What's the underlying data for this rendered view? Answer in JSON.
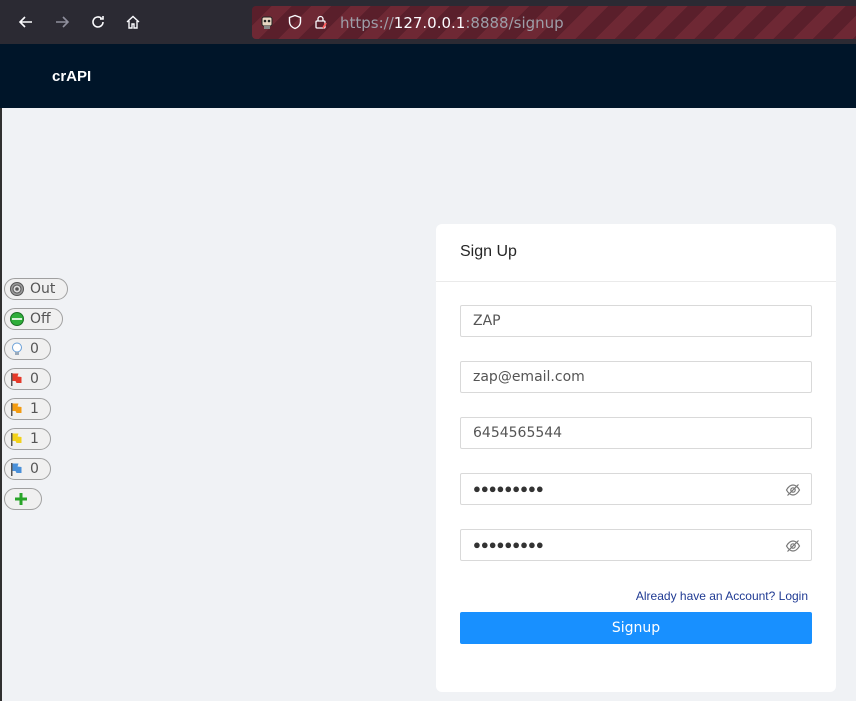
{
  "browser": {
    "url_scheme": "https://",
    "url_host": "127.0.0.1",
    "url_rest": ":8888/signup"
  },
  "app": {
    "brand": "crAPI"
  },
  "zap": {
    "items": [
      {
        "icon": "target-icon",
        "label": "Out"
      },
      {
        "icon": "green-circle-icon",
        "label": "Off"
      },
      {
        "icon": "lightbulb-icon",
        "label": "0"
      },
      {
        "icon": "red-flag-icon",
        "label": "0"
      },
      {
        "icon": "orange-flag-icon",
        "label": "1"
      },
      {
        "icon": "yellow-flag-icon",
        "label": "1"
      },
      {
        "icon": "blue-flag-icon",
        "label": "0"
      },
      {
        "icon": "plus-icon",
        "label": ""
      }
    ]
  },
  "signup": {
    "title": "Sign Up",
    "name_value": "ZAP",
    "email_value": "zap@email.com",
    "phone_value": "6454565544",
    "password_mask": "●●●●●●●●●",
    "confirm_mask": "●●●●●●●●●",
    "login_link": "Already have an Account? Login",
    "submit_label": "Signup"
  },
  "colors": {
    "header": "#001529",
    "primary": "#1890ff",
    "link": "#1f3a93"
  }
}
